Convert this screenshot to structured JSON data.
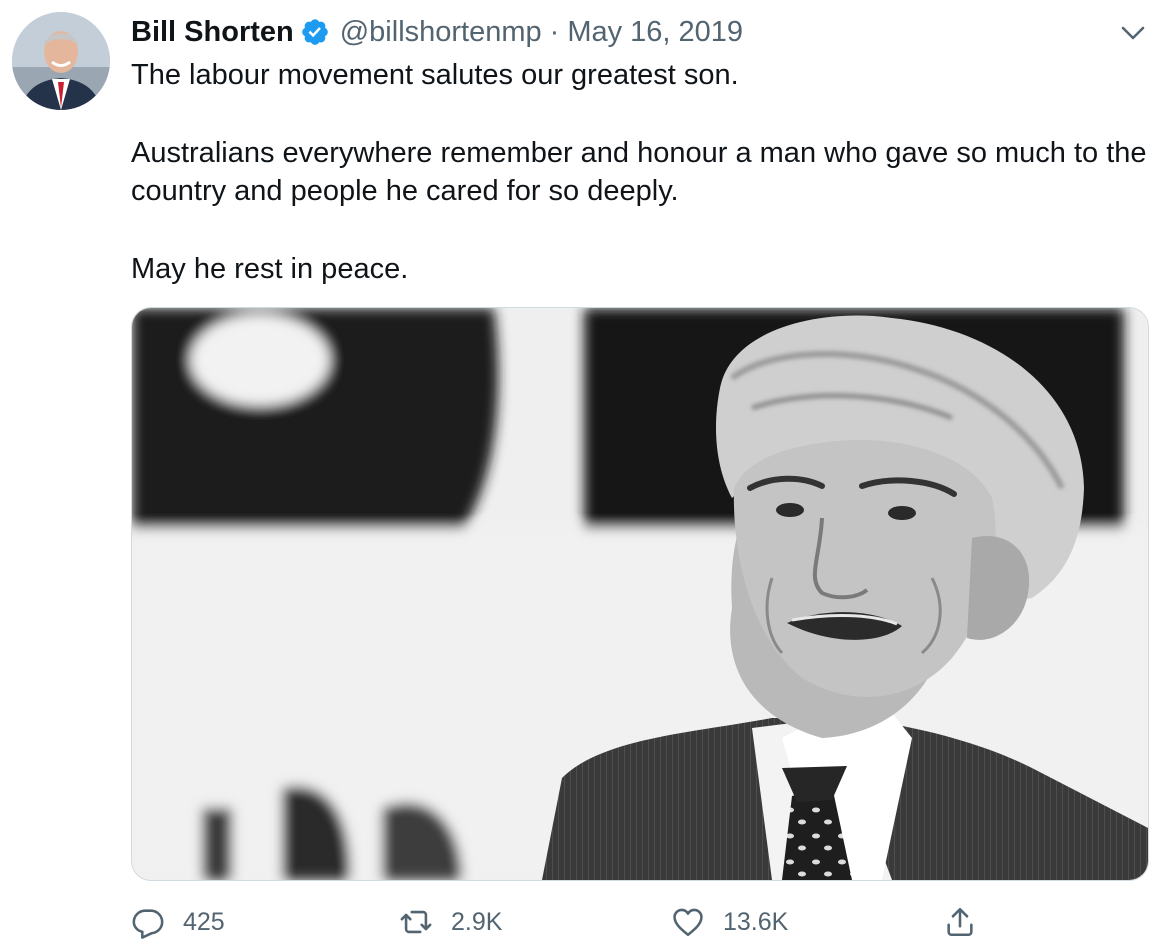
{
  "tweet": {
    "author": {
      "name": "Bill Shorten",
      "handle": "@billshortenmp",
      "verified_icon": "verified-badge-icon",
      "avatar_icon": "avatar-photo"
    },
    "separator": "·",
    "date": "May 16, 2019",
    "text": {
      "line1": "The labour movement salutes our greatest son.",
      "line2": "Australians everywhere remember and honour a man who gave so much to the country and people he cared for so deeply.",
      "line3": "May he rest in peace."
    },
    "media": {
      "type": "photo",
      "style": "black-and-white"
    },
    "actions": {
      "replies": "425",
      "retweets": "2.9K",
      "likes": "13.6K"
    }
  },
  "colors": {
    "text": "#0f1419",
    "secondary": "#536471",
    "verified": "#1d9bf0",
    "border": "#cfd9de"
  }
}
